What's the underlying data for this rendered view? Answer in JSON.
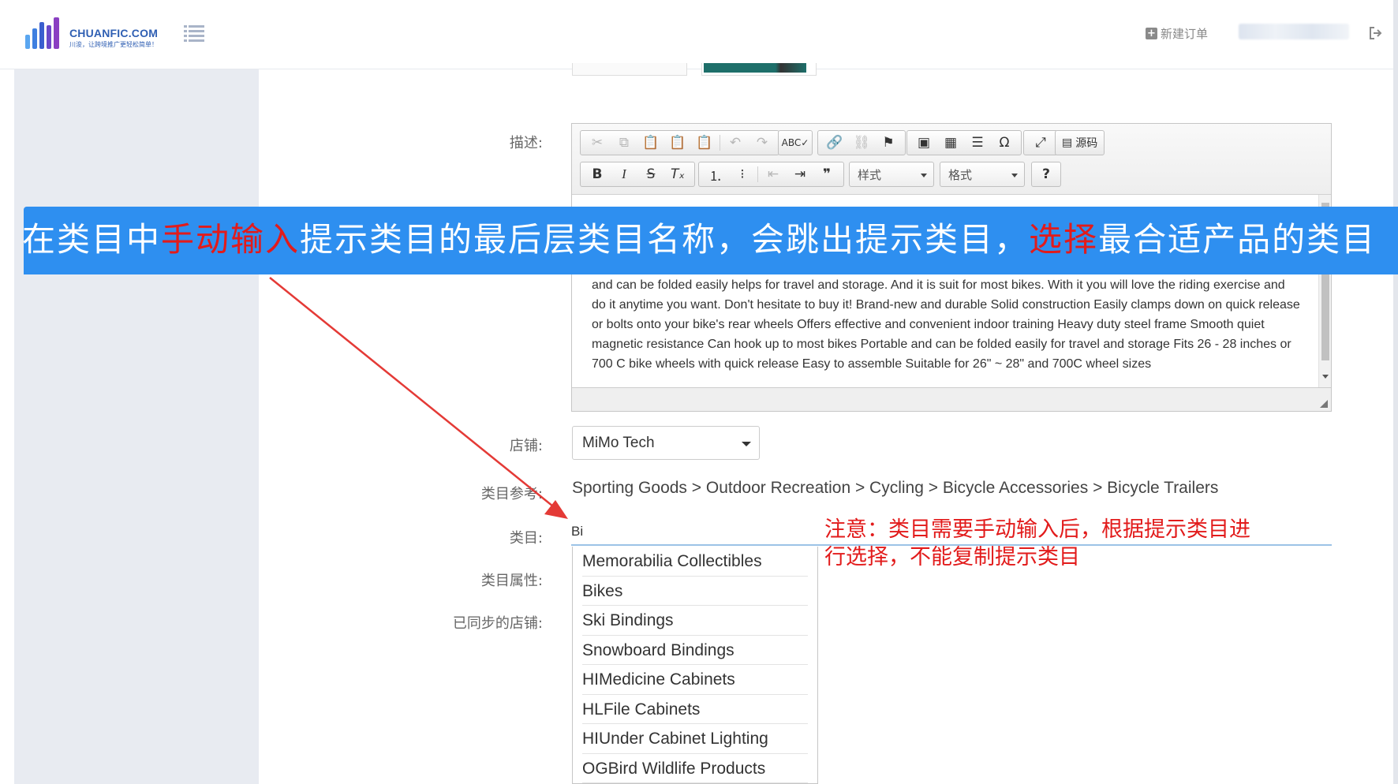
{
  "header": {
    "logo_text": "CHUANFIC.COM",
    "logo_tagline": "川浚，让跨境推广更轻松简单！",
    "new_order_label": "新建订单",
    "icons": {
      "menu": "list-icon",
      "new_order": "plus-square-icon",
      "logout": "sign-out-icon"
    }
  },
  "form": {
    "description_label": "描述:",
    "store_label": "店铺:",
    "category_ref_label": "类目参考:",
    "category_label": "类目:",
    "category_attr_label": "类目属性:",
    "synced_stores_label": "已同步的店铺:"
  },
  "editor": {
    "source_label": "源码",
    "style_combo": "样式",
    "format_combo": "格式",
    "content": "and can be folded easily helps for travel and storage. And it is suit for most bikes. With it you will love the riding exercise and do it anytime you want.   Don't hesitate to buy it!   Brand-new and durable Solid construction Easily clamps down on quick release or bolts onto your bike's rear wheels Offers effective and convenient indoor training Heavy duty steel frame Smooth quiet magnetic resistance Can hook up to most bikes Portable and can be folded easily for travel and storage Fits 26 - 28 inches or 700 C bike wheels with quick release Easy to assemble Suitable for 26\" ~ 28\"  and 700C wheel sizes"
  },
  "store_value": "MiMo Tech",
  "category_reference": "Sporting Goods > Outdoor Recreation > Cycling > Bicycle Accessories > Bicycle Trailers",
  "category_input_value": "Bi",
  "suggestions": [
    "Memorabilia Collectibles",
    "Bikes",
    "Ski Bindings",
    "Snowboard Bindings",
    "HIMedicine Cabinets",
    "HLFile Cabinets",
    "HIUnder Cabinet Lighting",
    "OGBird Wildlife Products"
  ],
  "annotation": {
    "banner_part1": "在类目中",
    "banner_hl1": "手动输入",
    "banner_part2": "提示类目的最后层类目名称，会跳出提示类目，",
    "banner_hl2": "选择",
    "banner_part3": "最合适产品的类目",
    "note": "注意：类目需要手动输入后，根据提示类目进行选择，不能复制提示类目"
  },
  "colors": {
    "banner": "#2e8ff0",
    "highlight": "#e21b1b",
    "sidebar": "#e8ebf1",
    "brand": "#2f5fb3"
  }
}
